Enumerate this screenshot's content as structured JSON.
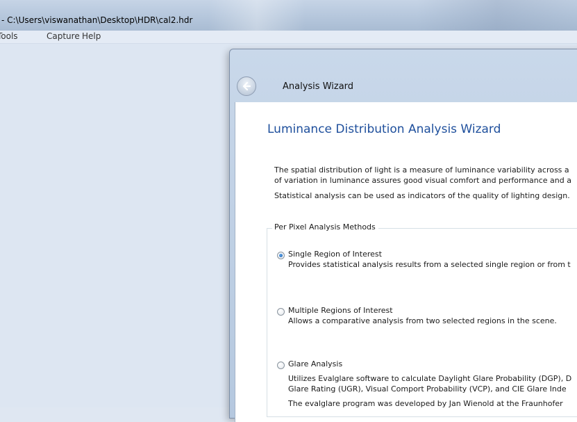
{
  "app": {
    "title": "- C:\\Users\\viswanathan\\Desktop\\HDR\\cal2.hdr",
    "menu": [
      "Tools",
      "Capture",
      "Help"
    ]
  },
  "wizard": {
    "window_title": "Analysis Wizard",
    "heading": "Luminance Distribution Analysis Wizard",
    "intro_lines": [
      "The spatial distribution of light is a measure of luminance variability across a",
      "of variation in luminance assures good visual comfort and performance and a",
      "Statistical analysis can be used as indicators of the quality of lighting design."
    ],
    "group_title": "Per Pixel Analysis Methods",
    "options": [
      {
        "label": "Single Region of Interest",
        "checked": true,
        "description": [
          "Provides statistical analysis results from a selected single region or from t"
        ]
      },
      {
        "label": "Multiple Regions of Interest",
        "checked": false,
        "description": [
          "Allows a comparative analysis from two selected regions in the scene."
        ]
      },
      {
        "label": "Glare Analysis",
        "checked": false,
        "description": [
          "Utilizes Evalglare software to calculate Daylight Glare Probability (DGP), D",
          "Glare Rating (UGR), Visual Comport Probability (VCP), and CIE Glare Inde",
          "The evalglare program was developed by Jan Wienold at the Fraunhofer"
        ]
      }
    ]
  },
  "colors": {
    "heading": "#1e4f9c",
    "titlebar": "#b8c9de",
    "workspace": "#dde6f2"
  }
}
